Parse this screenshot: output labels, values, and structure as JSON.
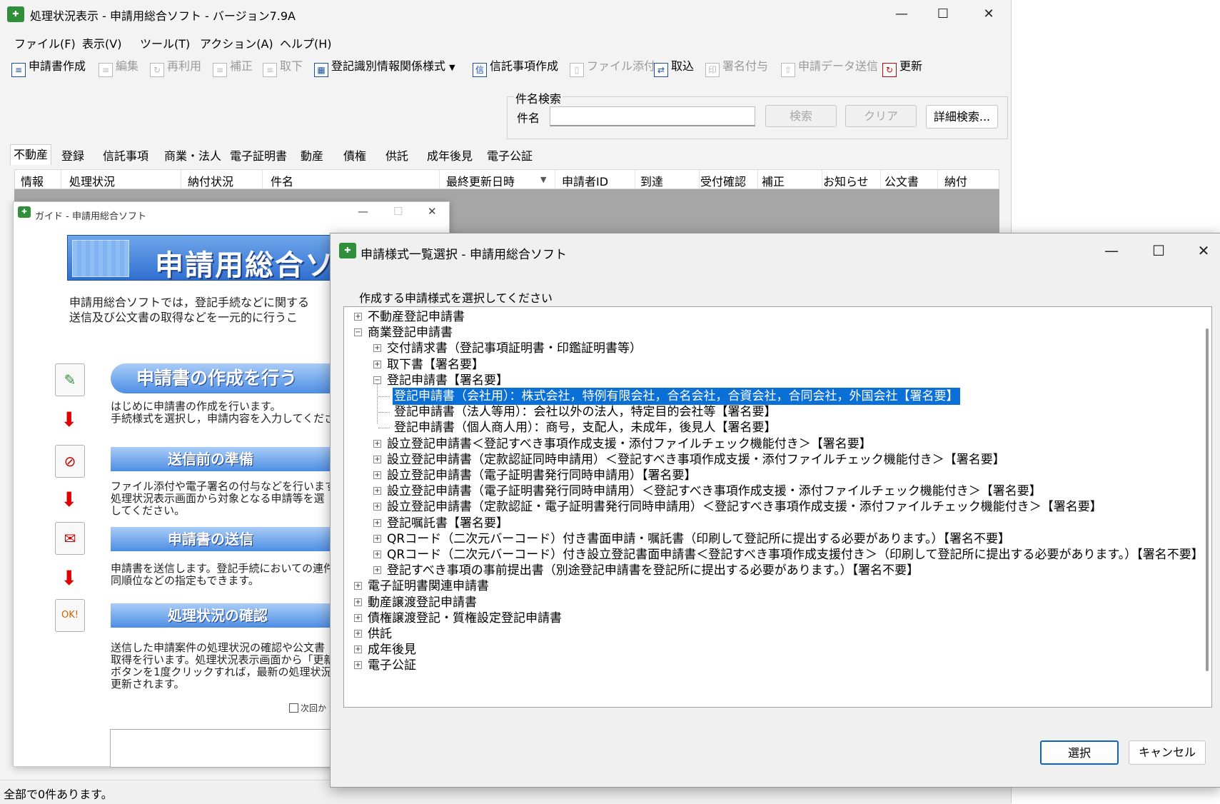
{
  "main_window": {
    "title": "処理状況表示 - 申請用総合ソフト - バージョン7.9A",
    "menu": [
      "ファイル(F)",
      "表示(V)",
      "ツール(T)",
      "アクション(A)",
      "ヘルプ(H)"
    ],
    "toolbar": [
      {
        "label": "申請書作成",
        "enabled": true,
        "icon": "form-icon"
      },
      {
        "label": "編集",
        "enabled": false,
        "icon": "edit-icon"
      },
      {
        "label": "再利用",
        "enabled": false,
        "icon": "reuse-icon"
      },
      {
        "label": "補正",
        "enabled": false,
        "icon": "amend-icon"
      },
      {
        "label": "取下",
        "enabled": false,
        "icon": "withdraw-icon"
      },
      {
        "label": "登記識別情報関係様式",
        "enabled": true,
        "icon": "registry-icon",
        "dropdown": true
      },
      {
        "label": "信託事項作成",
        "enabled": true,
        "icon": "trust-icon"
      },
      {
        "label": "ファイル添付",
        "enabled": false,
        "icon": "attach-icon"
      },
      {
        "label": "取込",
        "enabled": true,
        "icon": "import-icon"
      },
      {
        "label": "署名付与",
        "enabled": false,
        "icon": "sign-icon"
      },
      {
        "label": "申請データ送信",
        "enabled": false,
        "icon": "send-icon"
      },
      {
        "label": "更新",
        "enabled": true,
        "icon": "refresh-icon"
      }
    ],
    "search": {
      "group_label": "件名検索",
      "field_label": "件名",
      "value": "",
      "search_button": "検索",
      "clear_button": "クリア",
      "advanced_button": "詳細検索..."
    },
    "tabs": [
      "不動産",
      "登録",
      "信託事項",
      "商業・法人",
      "電子証明書",
      "動産",
      "債権",
      "供託",
      "成年後見",
      "電子公証"
    ],
    "active_tab": "不動産",
    "columns": [
      "情報",
      "処理状況",
      "納付状況",
      "件名",
      "最終更新日時",
      "申請者ID",
      "到達",
      "受付確認",
      "補正",
      "お知らせ",
      "公文書",
      "納付"
    ],
    "status": "全部で0件あります。"
  },
  "guide_window": {
    "title": "ガイド - 申請用総合ソフト",
    "banner": "申請用総合ソフト",
    "intro": "申請用総合ソフトでは，登記手続などに関する\n送信及び公文書の取得などを一元的に行うこ",
    "steps": [
      {
        "title": "申請書の作成を行う",
        "desc": "はじめに申請書の作成を行います。\n手続様式を選択し，申請内容を入力してくださ",
        "icon": "pencil-icon"
      },
      {
        "title": "送信前の準備",
        "desc": "ファイル添付や電子署名の付与などを行います\n処理状況表示画面から対象となる申請等を選\nしてください。",
        "icon": "paperclip-icon"
      },
      {
        "title": "申請書の送信",
        "desc": "申請書を送信します。登記手続においての連件\n同順位などの指定もできます。",
        "icon": "mail-icon"
      },
      {
        "title": "処理状況の確認",
        "desc": "送信した申請案件の処理状況の確認や公文書\n取得を行います。処理状況表示画面から「更新\nボタンを1度クリックすれば，最新の処理状況に\n更新されます。",
        "icon": "monitor-ok-icon"
      }
    ],
    "checkbox_label": "次回か"
  },
  "form_dialog": {
    "title": "申請様式一覧選択 - 申請用総合ソフト",
    "prompt": "作成する申請様式を選択してください",
    "tree": [
      {
        "label": "不動産登記申請書",
        "level": 0,
        "expander": "+"
      },
      {
        "label": "商業登記申請書",
        "level": 0,
        "expander": "-"
      },
      {
        "label": "交付請求書（登記事項証明書・印鑑証明書等）",
        "level": 1,
        "expander": "+"
      },
      {
        "label": "取下書【署名要】",
        "level": 1,
        "expander": "+"
      },
      {
        "label": "登記申請書【署名要】",
        "level": 1,
        "expander": "-"
      },
      {
        "label": "登記申請書（会社用）：株式会社，特例有限会社，合名会社，合資会社，合同会社，外国会社【署名要】",
        "level": 2,
        "expander": "",
        "selected": true
      },
      {
        "label": "登記申請書（法人等用）：会社以外の法人，特定目的会社等【署名要】",
        "level": 2,
        "expander": ""
      },
      {
        "label": "登記申請書（個人商人用）：商号，支配人，未成年，後見人【署名要】",
        "level": 2,
        "expander": ""
      },
      {
        "label": "設立登記申請書＜登記すべき事項作成支援・添付ファイルチェック機能付き＞【署名要】",
        "level": 1,
        "expander": "+"
      },
      {
        "label": "設立登記申請書（定款認証同時申請用）＜登記すべき事項作成支援・添付ファイルチェック機能付き＞【署名要】",
        "level": 1,
        "expander": "+"
      },
      {
        "label": "設立登記申請書（電子証明書発行同時申請用）【署名要】",
        "level": 1,
        "expander": "+"
      },
      {
        "label": "設立登記申請書（電子証明書発行同時申請用）＜登記すべき事項作成支援・添付ファイルチェック機能付き＞【署名要】",
        "level": 1,
        "expander": "+"
      },
      {
        "label": "設立登記申請書（定款認証・電子証明書発行同時申請用）＜登記すべき事項作成支援・添付ファイルチェック機能付き＞【署名要】",
        "level": 1,
        "expander": "+"
      },
      {
        "label": "登記嘱託書【署名要】",
        "level": 1,
        "expander": "+"
      },
      {
        "label": "QRコード（二次元バーコード）付き書面申請・嘱託書（印刷して登記所に提出する必要があります。）【署名不要】",
        "level": 1,
        "expander": "+"
      },
      {
        "label": "QRコード（二次元バーコード）付き設立登記書面申請書＜登記すべき事項作成支援付き＞（印刷して登記所に提出する必要があります。）【署名不要】",
        "level": 1,
        "expander": "+"
      },
      {
        "label": "登記すべき事項の事前提出書（別途登記申請書を登記所に提出する必要があります。）【署名不要】",
        "level": 1,
        "expander": "+"
      },
      {
        "label": "電子証明書関連申請書",
        "level": 0,
        "expander": "+"
      },
      {
        "label": "動産譲渡登記申請書",
        "level": 0,
        "expander": "+"
      },
      {
        "label": "債権譲渡登記・質権設定登記申請書",
        "level": 0,
        "expander": "+"
      },
      {
        "label": "供託",
        "level": 0,
        "expander": "+"
      },
      {
        "label": "成年後見",
        "level": 0,
        "expander": "+"
      },
      {
        "label": "電子公証",
        "level": 0,
        "expander": "+"
      }
    ],
    "select_button": "選択",
    "cancel_button": "キャンセル"
  }
}
